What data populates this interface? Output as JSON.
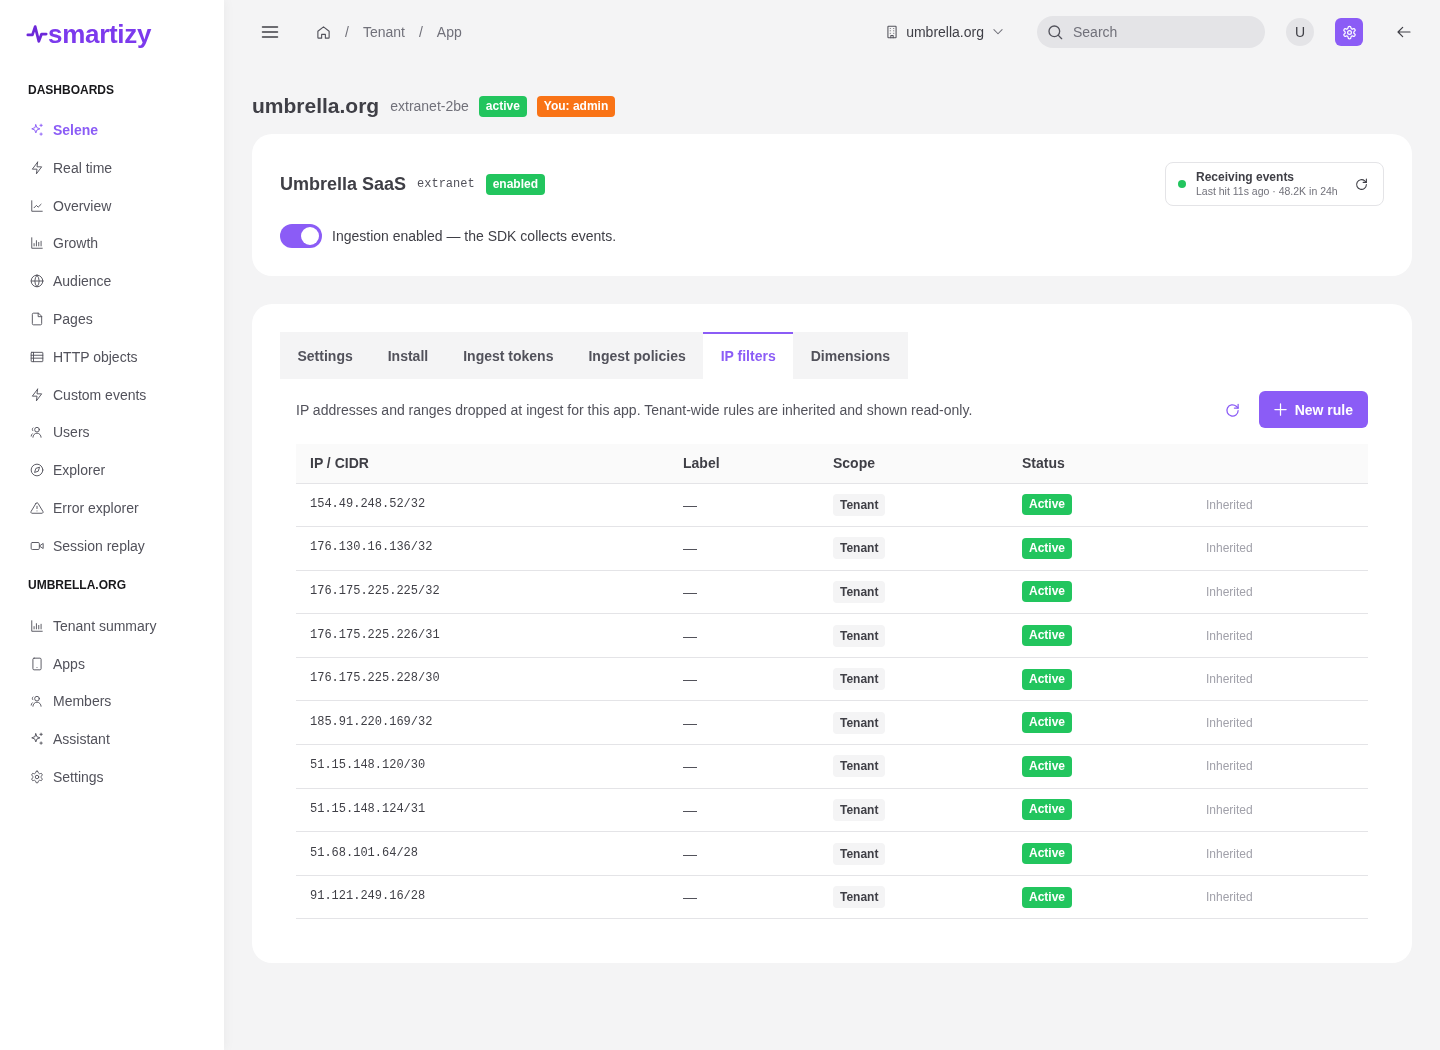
{
  "sidebar": {
    "logo": "smartizy",
    "sections": [
      {
        "heading": "DASHBOARDS",
        "items": [
          {
            "label": "Selene",
            "selected": true
          },
          {
            "label": "Real time",
            "selected": false
          },
          {
            "label": "Overview",
            "selected": false
          },
          {
            "label": "Growth",
            "selected": false
          },
          {
            "label": "Audience",
            "selected": false
          },
          {
            "label": "Pages",
            "selected": false
          },
          {
            "label": "HTTP objects",
            "selected": false
          },
          {
            "label": "Custom events",
            "selected": false
          },
          {
            "label": "Users",
            "selected": false
          },
          {
            "label": "Explorer",
            "selected": false
          },
          {
            "label": "Error explorer",
            "selected": false
          },
          {
            "label": "Session replay",
            "selected": false
          }
        ]
      },
      {
        "heading": "UMBRELLA.ORG",
        "items": [
          {
            "label": "Tenant summary",
            "selected": false
          },
          {
            "label": "Apps",
            "selected": false
          },
          {
            "label": "Members",
            "selected": false
          },
          {
            "label": "Assistant",
            "selected": false
          },
          {
            "label": "Settings",
            "selected": false
          }
        ]
      }
    ]
  },
  "topbar": {
    "breadcrumbs": [
      {
        "kind": "home"
      },
      {
        "kind": "separator",
        "text": "/"
      },
      {
        "kind": "link",
        "text": "Tenant"
      },
      {
        "kind": "separator",
        "text": "/"
      },
      {
        "kind": "link",
        "text": "App"
      }
    ],
    "org_switcher": "umbrella.org",
    "search": {
      "placeholder": "Search"
    },
    "avatar": "U"
  },
  "header": {
    "title": "umbrella.org",
    "subtitle": "extranet-2be",
    "badges": [
      {
        "text": "active",
        "color": "#22c55e"
      },
      {
        "text": "You: admin",
        "color": "#f97316"
      }
    ]
  },
  "app_card": {
    "name": "Umbrella SaaS",
    "environment": "extranet",
    "badge": "enabled",
    "status": {
      "title": "Receiving events",
      "detail": "Last hit 11s ago · 48.2K in 24h"
    },
    "ingestion": {
      "on": true,
      "label": "Ingestion enabled — the SDK collects events."
    }
  },
  "rules_card": {
    "tabs": [
      {
        "label": "Settings",
        "selected": false
      },
      {
        "label": "Install",
        "selected": false
      },
      {
        "label": "Ingest tokens",
        "selected": false
      },
      {
        "label": "Ingest policies",
        "selected": false
      },
      {
        "label": "IP filters",
        "selected": true
      },
      {
        "label": "Dimensions",
        "selected": false
      }
    ],
    "description": "IP addresses and ranges dropped at ingest for this app. Tenant-wide rules are inherited and shown read-only.",
    "new_rule_button": "New rule",
    "table": {
      "columns": [
        "IP / CIDR",
        "Label",
        "Scope",
        "Status"
      ],
      "rows": [
        {
          "ip_cidr": "154.49.248.52/32",
          "label": "—",
          "scope": "Tenant",
          "status": "Active",
          "column_5": "Inherited"
        },
        {
          "ip_cidr": "176.130.16.136/32",
          "label": "—",
          "scope": "Tenant",
          "status": "Active",
          "column_5": "Inherited"
        },
        {
          "ip_cidr": "176.175.225.225/32",
          "label": "—",
          "scope": "Tenant",
          "status": "Active",
          "column_5": "Inherited"
        },
        {
          "ip_cidr": "176.175.225.226/31",
          "label": "—",
          "scope": "Tenant",
          "status": "Active",
          "column_5": "Inherited"
        },
        {
          "ip_cidr": "176.175.225.228/30",
          "label": "—",
          "scope": "Tenant",
          "status": "Active",
          "column_5": "Inherited"
        },
        {
          "ip_cidr": "185.91.220.169/32",
          "label": "—",
          "scope": "Tenant",
          "status": "Active",
          "column_5": "Inherited"
        },
        {
          "ip_cidr": "51.15.148.120/30",
          "label": "—",
          "scope": "Tenant",
          "status": "Active",
          "column_5": "Inherited"
        },
        {
          "ip_cidr": "51.15.148.124/31",
          "label": "—",
          "scope": "Tenant",
          "status": "Active",
          "column_5": "Inherited"
        },
        {
          "ip_cidr": "51.68.101.64/28",
          "label": "—",
          "scope": "Tenant",
          "status": "Active",
          "column_5": "Inherited"
        },
        {
          "ip_cidr": "91.121.249.16/28",
          "label": "—",
          "scope": "Tenant",
          "status": "Active",
          "column_5": "Inherited"
        }
      ]
    }
  }
}
